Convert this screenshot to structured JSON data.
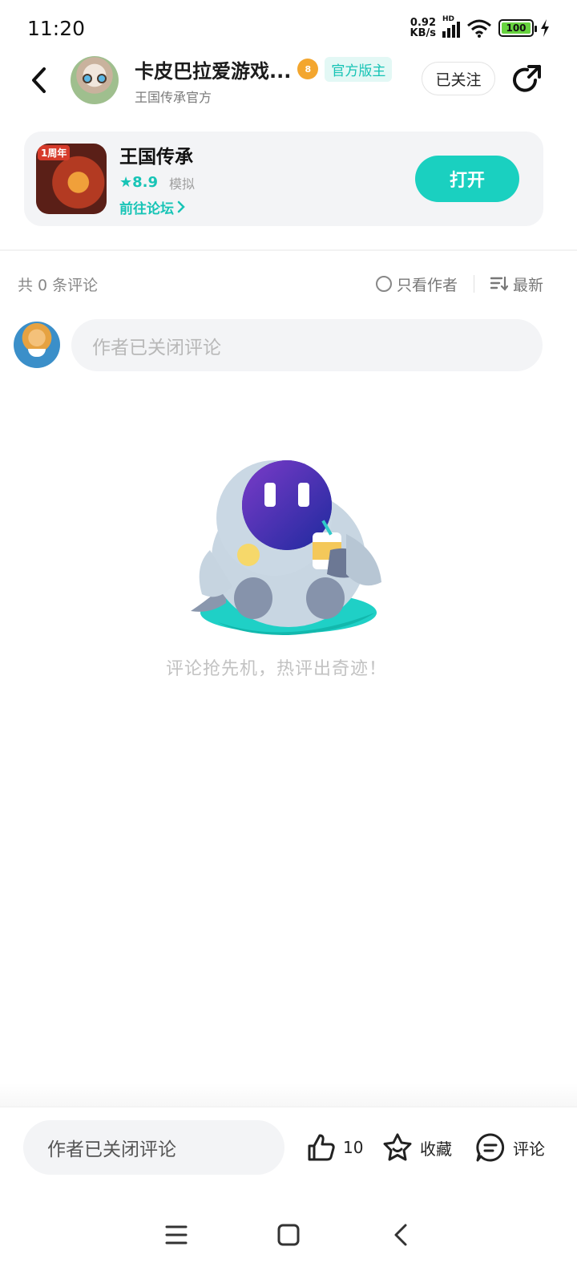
{
  "status_bar": {
    "time": "11:20",
    "net_speed_value": "0.92",
    "net_speed_unit": "KB/s",
    "signal_label": "HD",
    "battery": "100"
  },
  "header": {
    "title": "卡皮巴拉爱游戏...",
    "level": "8",
    "official_badge": "官方版主",
    "subtitle": "王国传承官方",
    "follow_label": "已关注"
  },
  "game_card": {
    "icon_tag": "1周年",
    "name": "王国传承",
    "rating": "★8.9",
    "genre": "模拟",
    "forum_link": "前往论坛",
    "open_label": "打开"
  },
  "comments": {
    "count_label": "共 0 条评论",
    "only_author_label": "只看作者",
    "sort_label": "最新",
    "input_placeholder": "作者已关闭评论",
    "empty_text": "评论抢先机，热评出奇迹！"
  },
  "bottom_bar": {
    "input_placeholder": "作者已关闭评论",
    "like_count": "10",
    "favorite_label": "收藏",
    "comment_label": "评论"
  },
  "colors": {
    "accent": "#1ad0c0",
    "accent_text": "#17c4b6"
  }
}
